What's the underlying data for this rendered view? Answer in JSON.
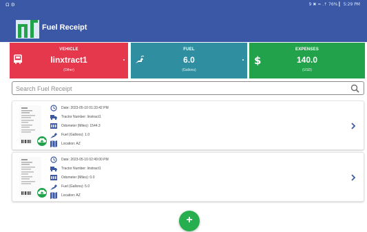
{
  "statusbar": {
    "left": "Ω ⚙",
    "right": "9 ✖ ≈ .↑ 76% ▎ 5:29 PM"
  },
  "header": {
    "title": "Fuel Receipt"
  },
  "cards": {
    "vehicle": {
      "title": "VEHICLE",
      "value": "linxtract1",
      "unit": "(Other)",
      "color": "#e5384d"
    },
    "fuel": {
      "title": "FUEL",
      "value": "6.0",
      "unit": "(Gallons)",
      "color": "#2f8fa0"
    },
    "expenses": {
      "title": "EXPENSES",
      "value": "140.0",
      "unit": "(USD)",
      "color": "#22a24a"
    }
  },
  "search": {
    "placeholder": "Search Fuel Receipt",
    "value": ""
  },
  "receipts": [
    {
      "date": "Date: 2023-05-10 01:33:42 PM",
      "tractor": "Tractor Number: linxtract1",
      "odometer": "Odometer (Miles): 1544.3",
      "fuel": "Fuel (Gallons): 1.0",
      "location": "Location: AZ"
    },
    {
      "date": "Date: 2023-05-10 02:49:00 PM",
      "tractor": "Tractor Number: linxtract1",
      "odometer": "Odometer (Miles): 0.0",
      "fuel": "Fuel (Gallons): 5.0",
      "location": "Location: AZ"
    }
  ],
  "fab": {
    "label": "+"
  },
  "icons": {
    "vehicle": "truck-icon",
    "fuel": "fuel-pump-icon",
    "expenses": "dollar-icon",
    "search": "search-icon",
    "date": "clock-icon",
    "tractor": "truck-icon",
    "odometer": "odometer-icon",
    "fuel_row": "fuel-nozzle-icon",
    "location": "map-icon",
    "upload": "cloud-upload-icon",
    "chevron": "chevron-right-icon"
  },
  "colors": {
    "header": "#3a58a6",
    "row_icon": "#3a58a6",
    "fab": "#27ae4f"
  }
}
